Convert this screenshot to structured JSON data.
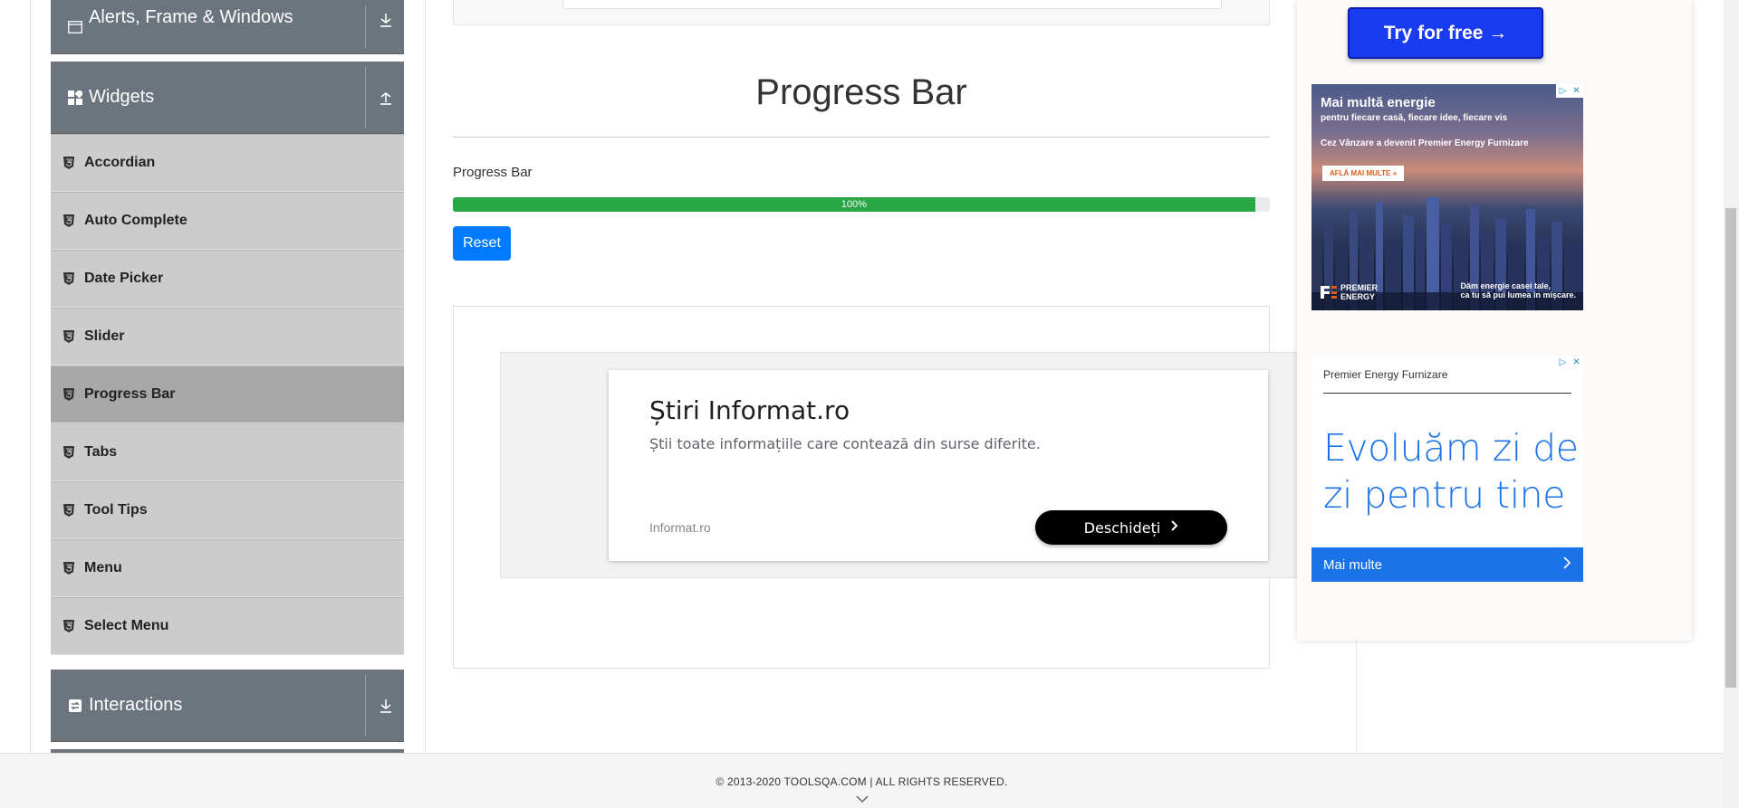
{
  "sidebar": {
    "groups": [
      {
        "label": "Alerts, Frame & Windows",
        "icon": "window-icon",
        "toggle_icon": "download-arrow-icon"
      },
      {
        "label": "Widgets",
        "icon": "widgets-icon",
        "toggle_icon": "upload-arrow-icon"
      },
      {
        "label": "Interactions",
        "icon": "interactions-icon",
        "toggle_icon": "download-arrow-icon"
      }
    ],
    "widget_items": [
      {
        "label": "Accordian"
      },
      {
        "label": "Auto Complete"
      },
      {
        "label": "Date Picker"
      },
      {
        "label": "Slider"
      },
      {
        "label": "Progress Bar",
        "active": true
      },
      {
        "label": "Tabs"
      },
      {
        "label": "Tool Tips"
      },
      {
        "label": "Menu"
      },
      {
        "label": "Select Menu"
      }
    ]
  },
  "main": {
    "title": "Progress Bar",
    "progress_label": "Progress Bar",
    "progress_value": 100,
    "progress_text": "100%",
    "reset_label": "Reset",
    "progress_color": "#28a745",
    "button_color": "#007bff"
  },
  "ad_center": {
    "title": "Știri Informat.ro",
    "description": "Știi toate informațiile care contează din surse diferite.",
    "domain": "Informat.ro",
    "button": "Deschideți"
  },
  "right_ads": {
    "try_free": "Try for free →",
    "city_ad": {
      "headline": "Mai multă energie",
      "subline": "pentru fiecare casă, fiecare idee, fiecare vis",
      "line3": "Cez Vânzare a devenit Premier Energy Furnizare",
      "cta": "AFLĂ MAI MULTE",
      "logo_line1": "PREMIER",
      "logo_line2": "ENERGY",
      "slogan_line1": "Dăm energie casei tale,",
      "slogan_line2": "ca tu să pui lumea în mișcare."
    },
    "evolu_ad": {
      "brand": "Premier Energy Furnizare",
      "headline_line1": "Evoluăm zi de",
      "headline_line2": "zi pentru tine",
      "more": "Mai multe"
    }
  },
  "footer": {
    "text": "© 2013-2020 TOOLSQA.COM | ALL RIGHTS RESERVED."
  }
}
